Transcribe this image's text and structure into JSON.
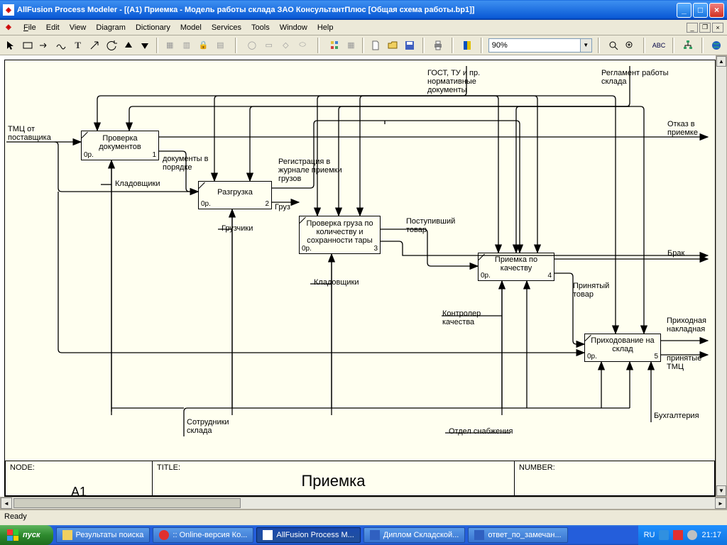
{
  "window": {
    "title": "AllFusion Process Modeler  - [(A1) Приемка - Модель работы склада ЗАО КонсультантПлюс  [Общая схема работы.bp1]]",
    "app_icon": "◈"
  },
  "menu": {
    "file": "File",
    "edit": "Edit",
    "view": "View",
    "diagram": "Diagram",
    "dictionary": "Dictionary",
    "model": "Model",
    "services": "Services",
    "tools": "Tools",
    "window": "Window",
    "help": "Help"
  },
  "toolbar": {
    "zoom_value": "90%"
  },
  "diagram": {
    "footer": {
      "node_label": "NODE:",
      "node_value": "A1",
      "title_label": "TITLE:",
      "title_value": "Приемка",
      "number_label": "NUMBER:"
    },
    "controls_top": {
      "c1": "ГОСТ, ТУ и пр. нормативные документы",
      "c2": "Регламент работы склада"
    },
    "input": "ТМЦ от поставщика",
    "outputs": {
      "o1": "Отказ в приемке",
      "o2": "Брак",
      "o3": "Приходная накладная",
      "o4": "принятые ТМЦ"
    },
    "mechs": {
      "m1": "Кладовщики",
      "m2": "Грузчики",
      "m3": "Кладовщики",
      "m4": "Контролер качества",
      "m5": "Сотрудники склада",
      "m6": "Отдел снабжения",
      "m7": "Бухгалтерия"
    },
    "inter": {
      "i1": "документы в порядке",
      "i2": "Регистрация в журнале приемки грузов",
      "i3": "Груз",
      "i4": "Поступивший товар",
      "i5": "Принятый товар"
    },
    "activities": [
      {
        "title": "Проверка документов",
        "bl": "0р.",
        "br": "1"
      },
      {
        "title": "Разгрузка",
        "bl": "0р.",
        "br": "2"
      },
      {
        "title": "Проверка груза по количеству и сохранности тары",
        "bl": "0р.",
        "br": "3"
      },
      {
        "title": "Приемка по качеству",
        "bl": "0р.",
        "br": "4"
      },
      {
        "title": "Приходование на склад",
        "bl": "0р.",
        "br": "5"
      }
    ]
  },
  "status": "Ready",
  "taskbar": {
    "start": "пуск",
    "tasks": [
      "Результаты поиска",
      ":: Online-версия Ко...",
      "AllFusion Process M...",
      "Диплом Складской...",
      "ответ_по_замечан..."
    ],
    "lang": "RU",
    "time": "21:17"
  }
}
